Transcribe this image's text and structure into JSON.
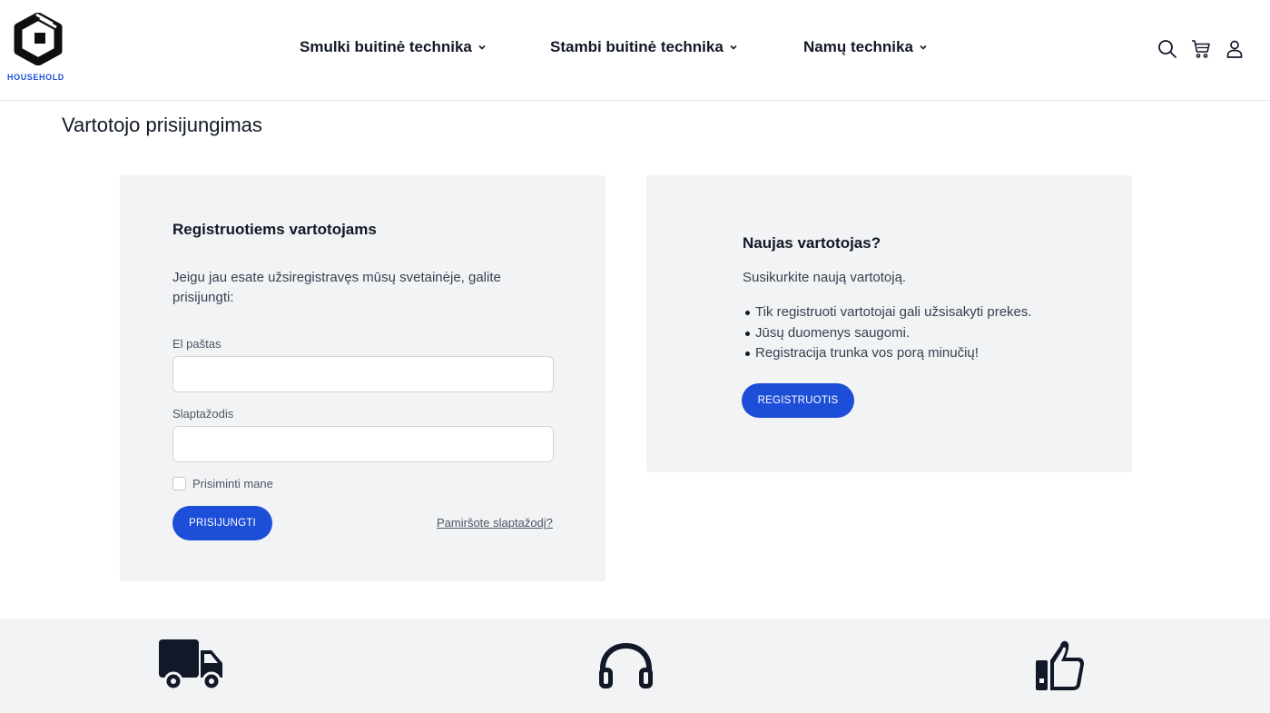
{
  "brand": {
    "logo_text": "HOUSEHOLD",
    "accent_color": "#1d4ed8",
    "logo_icon": "box-icon"
  },
  "nav": {
    "items": [
      {
        "label": "Smulki buitinė technika"
      },
      {
        "label": "Stambi buitinė technika"
      },
      {
        "label": "Namų technika"
      }
    ]
  },
  "header_icons": [
    "search-icon",
    "cart-icon",
    "user-icon"
  ],
  "page": {
    "title": "Vartotojo prisijungimas"
  },
  "login": {
    "heading": "Registruotiems vartotojams",
    "intro": "Jeigu jau esate užsiregistravęs mūsų svetainėje, galite prisijungti:",
    "email_label": "El paštas",
    "email_value": "",
    "password_label": "Slaptažodis",
    "password_value": "",
    "remember_label": "Prisiminti mane",
    "remember_checked": false,
    "submit_label": "PRISIJUNGTI",
    "forgot_label": "Pamiršote slaptažodį?"
  },
  "register": {
    "heading": "Naujas vartotojas?",
    "intro": "Susikurkite naują vartotoją.",
    "bullets": [
      "Tik registruoti vartotojai gali užsisakyti prekes.",
      "Jūsų duomenys saugomi.",
      "Registracija trunka vos porą minučių!"
    ],
    "button_label": "REGISTRUOTIS"
  },
  "features": {
    "icons": [
      "truck-icon",
      "headphones-icon",
      "thumbs-up-icon"
    ]
  }
}
